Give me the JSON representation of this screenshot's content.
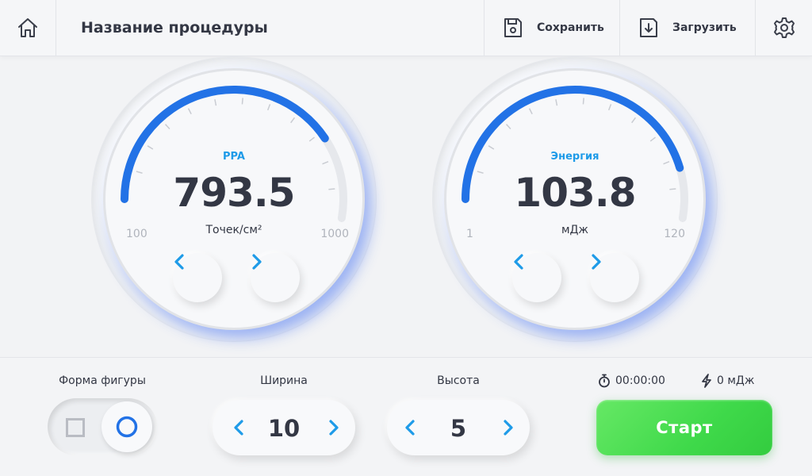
{
  "header": {
    "home_icon": "home-icon",
    "title": "Название процедуры",
    "save_label": "Сохранить",
    "save_icon": "floppy-disk-icon",
    "load_label": "Загрузить",
    "load_icon": "floppy-download-icon",
    "settings_icon": "gear-icon"
  },
  "gauges": [
    {
      "label": "PPA",
      "value": "793.5",
      "unit": "Точек/см²",
      "min": "100",
      "max": "1000",
      "fill_fraction": 0.77
    },
    {
      "label": "Энергия",
      "value": "103.8",
      "unit": "мДж",
      "min": "1",
      "max": "120",
      "fill_fraction": 0.86
    }
  ],
  "controls": {
    "shape_label": "Форма фигуры",
    "shape_selected": "circle",
    "width_label": "Ширина",
    "width_value": "10",
    "height_label": "Высота",
    "height_value": "5"
  },
  "status": {
    "timer": "00:00:00",
    "energy": "0 мДж"
  },
  "start_label": "Старт",
  "colors": {
    "accent": "#1e9be8",
    "arc": "#2272e6",
    "start": "#44dc4c",
    "text": "#333744"
  }
}
